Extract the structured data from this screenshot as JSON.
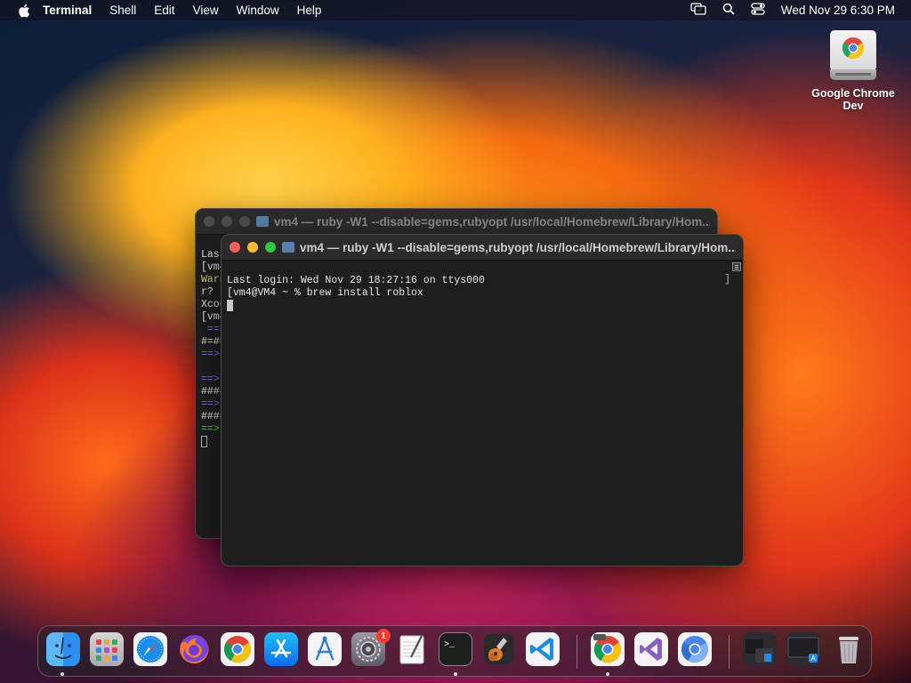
{
  "menubar": {
    "app_name": "Terminal",
    "items": [
      "Shell",
      "Edit",
      "View",
      "Window",
      "Help"
    ],
    "clock": "Wed Nov 29  6:30 PM"
  },
  "desktop_icon": {
    "label": "Google Chrome Dev"
  },
  "back_window": {
    "title": "vm4 — ruby -W1 --disable=gems,rubyopt /usr/local/Homebrew/Library/Hom...",
    "lines": [
      "Last",
      "[vm4@",
      "Warn",
      "r?",
      "Xcod",
      "[vm4@",
      " ==>",
      "#=#=",
      "==>",
      "",
      "==>",
      "####",
      "==>",
      "####",
      "==>"
    ]
  },
  "front_window": {
    "title": "vm4 — ruby -W1 --disable=gems,rubyopt /usr/local/Homebrew/Library/Hom...",
    "line1": "Last login: Wed Nov 29 18:27:16 on ttys000",
    "line2": "[vm4@VM4 ~ % brew install roblox"
  },
  "dock": {
    "apps": [
      "Finder",
      "Launchpad",
      "Safari",
      "Firefox",
      "Google Chrome",
      "App Store",
      "Xcode Instruments",
      "System Settings",
      "TextEdit",
      "Terminal",
      "GarageBand",
      "Visual Studio Code",
      "Google Chrome Dev",
      "Visual Studio",
      "Chromium"
    ],
    "settings_badge": "1"
  },
  "colors": {
    "red_light": "#ff5f57",
    "yellow_light": "#febc2e",
    "green_light": "#28c840"
  }
}
